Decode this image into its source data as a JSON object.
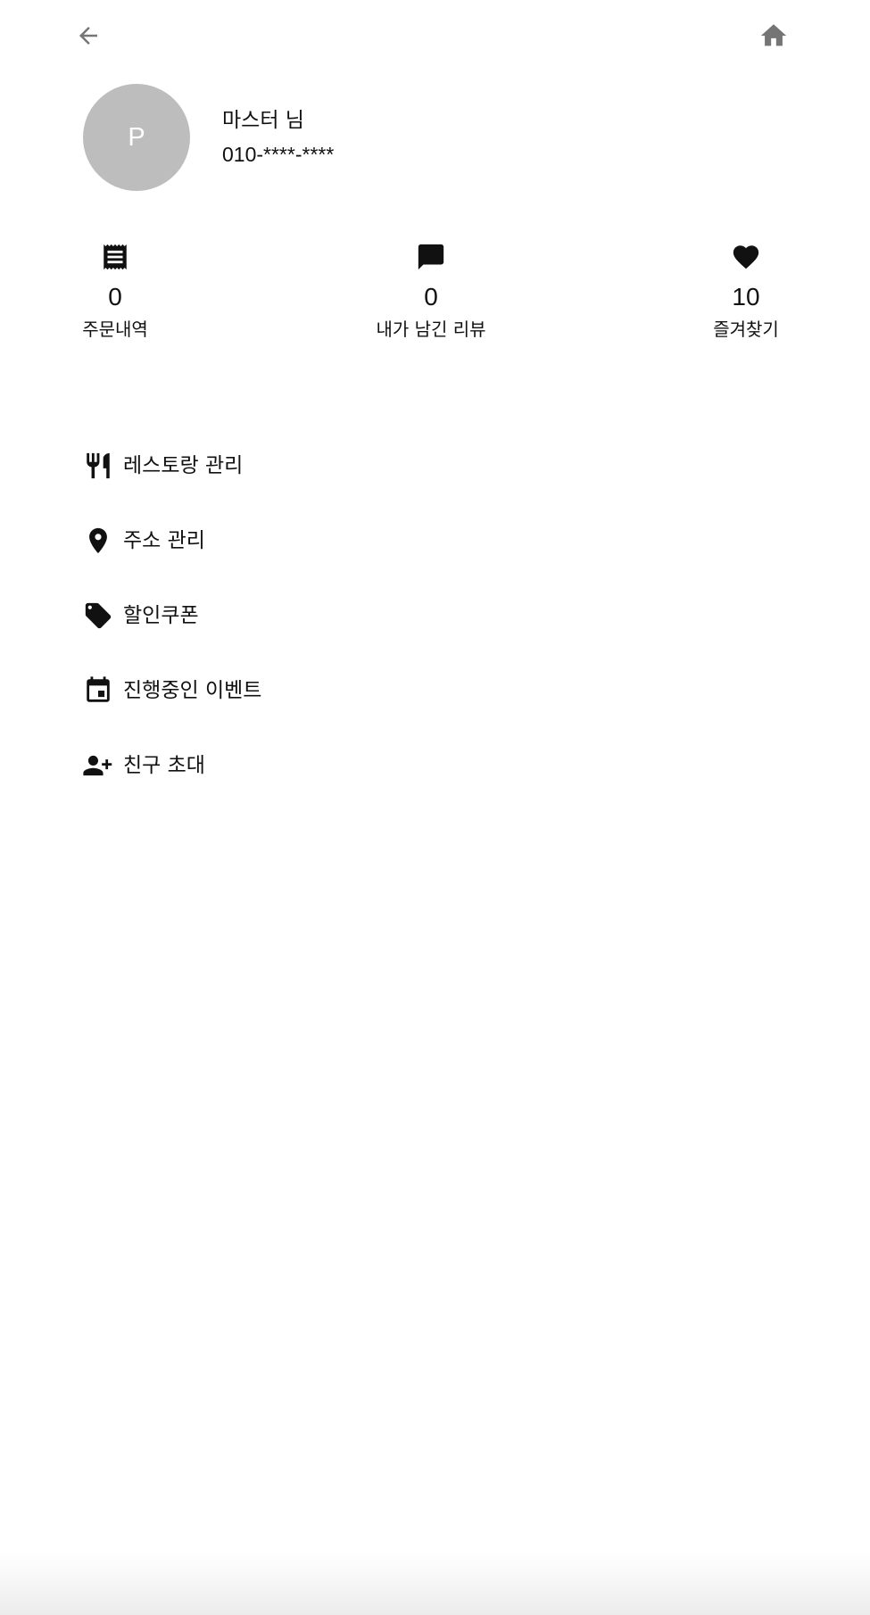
{
  "header": {
    "back_icon": "arrow-left-icon",
    "home_icon": "home-icon"
  },
  "profile": {
    "avatar_initial": "P",
    "avatar_color": "#bdbdbd",
    "name": "마스터 님",
    "phone": "010-****-****"
  },
  "stats": [
    {
      "icon": "receipt-icon",
      "count": "0",
      "label": "주문내역"
    },
    {
      "icon": "chat-icon",
      "count": "0",
      "label": "내가 남긴 리뷰"
    },
    {
      "icon": "heart-icon",
      "count": "10",
      "label": "즐겨찾기"
    }
  ],
  "menu": [
    {
      "icon": "restaurant-icon",
      "label": "레스토랑 관리"
    },
    {
      "icon": "location-pin-icon",
      "label": "주소 관리"
    },
    {
      "icon": "tag-icon",
      "label": "할인쿠폰"
    },
    {
      "icon": "calendar-event-icon",
      "label": "진행중인 이벤트"
    },
    {
      "icon": "person-add-icon",
      "label": "친구 초대"
    }
  ]
}
